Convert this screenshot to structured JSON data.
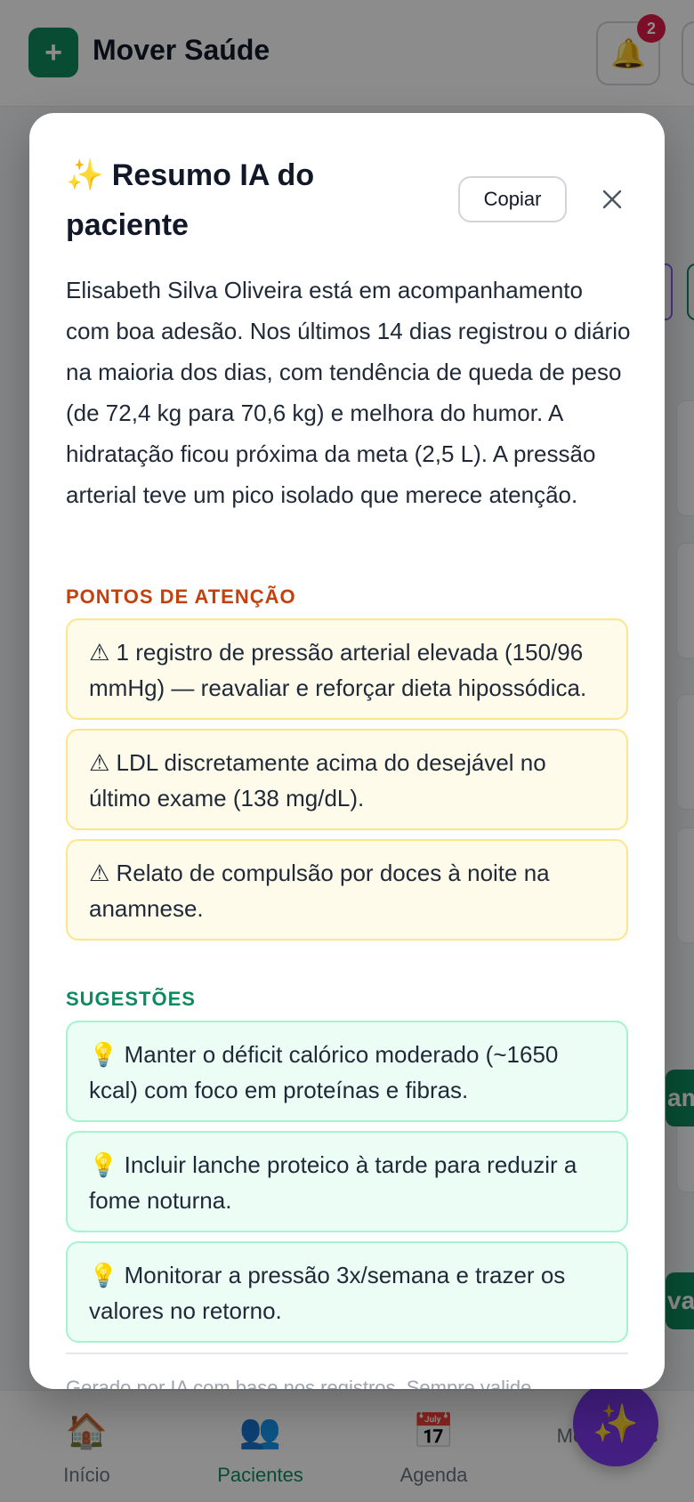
{
  "app": {
    "title": "Mover Saúde",
    "logo_symbol": "+",
    "notifications_count": "2"
  },
  "bg": {
    "button_fragment_1": "am",
    "button_fragment_2": "va"
  },
  "nav": {
    "items": [
      {
        "label": "Início",
        "icon": "home-icon",
        "glyph": "🏠"
      },
      {
        "label": "Pacientes",
        "icon": "patients-icon",
        "glyph": "👥",
        "active": true
      },
      {
        "label": "Agenda",
        "icon": "calendar-icon",
        "glyph": "📅"
      },
      {
        "label": "Mensagens",
        "icon": "messages-icon",
        "glyph": ""
      }
    ],
    "fab_glyph": "✨"
  },
  "modal": {
    "title": "✨ Resumo IA do paciente",
    "copy_label": "Copiar",
    "summary": "Elisabeth Silva Oliveira está em acompanhamento com boa adesão. Nos últimos 14 dias registrou o diário na maioria dos dias, com tendência de queda de peso (de 72,4 kg para 70,6 kg) e melhora do humor. A hidratação ficou próxima da meta (2,5 L). A pressão arterial teve um pico isolado que merece atenção.",
    "attention_title": "PONTOS DE ATENÇÃO",
    "attention": [
      "⚠ 1 registro de pressão arterial elevada (150/96 mmHg) — reavaliar e reforçar dieta hipossódica.",
      "⚠ LDL discretamente acima do desejável no último exame (138 mg/dL).",
      "⚠ Relato de compulsão por doces à noite na anamnese."
    ],
    "suggestions_title": "SUGESTÕES",
    "suggestions": [
      "💡 Manter o déficit calórico moderado (~1650 kcal) com foco em proteínas e fibras.",
      "💡 Incluir lanche proteico à tarde para reduzir a fome noturna.",
      "💡 Monitorar a pressão 3x/semana e trazer os valores no retorno."
    ],
    "footer_note": "Gerado por IA com base nos registros. Sempre valide."
  },
  "colors": {
    "brand": "#0f8a5f",
    "accent_purple": "#7c3aed",
    "warning_text": "#c2410c",
    "warning_bg": "#fffbeb",
    "suggestion_bg": "#ecfdf5",
    "badge": "#e11d48"
  }
}
